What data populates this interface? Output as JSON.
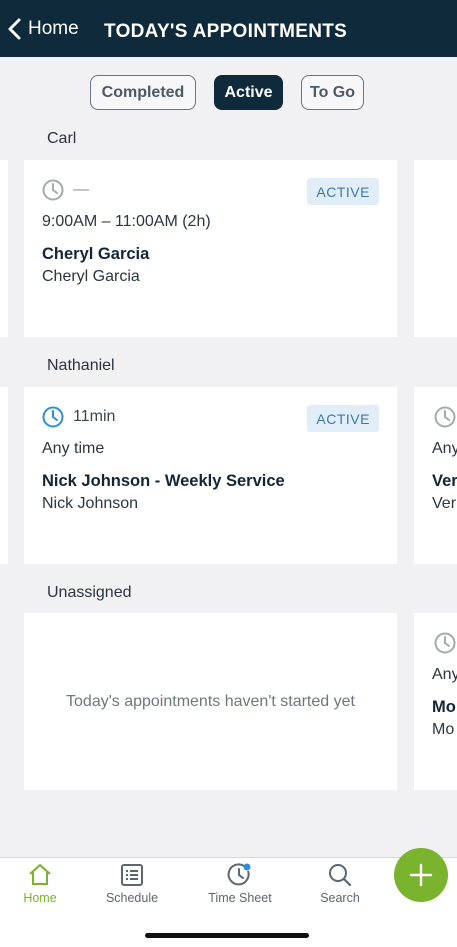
{
  "header": {
    "back_label": "Home",
    "title": "TODAY'S APPOINTMENTS",
    "background_color": "#0f2a3b"
  },
  "filters": [
    {
      "label": "Completed",
      "selected": false
    },
    {
      "label": "Active",
      "selected": true
    },
    {
      "label": "To Go",
      "selected": false
    }
  ],
  "groups": [
    {
      "name": "Carl",
      "card": {
        "duration": "—",
        "status": "ACTIVE",
        "time": "9:00AM – 11:00AM (2h)",
        "title": "Cheryl Garcia",
        "customer": "Cheryl Garcia",
        "clock_color": "#9aa2a9"
      }
    },
    {
      "name": "Nathaniel",
      "card": {
        "duration": "11min",
        "status": "ACTIVE",
        "time": "Any time",
        "title": "Nick Johnson - Weekly Service",
        "customer": "Nick Johnson",
        "clock_color": "#2f8fd6"
      },
      "next_card_peek": {
        "time": "Any",
        "title": "Ver",
        "customer": "Ver"
      }
    },
    {
      "name": "Unassigned",
      "empty_message": "Today's appointments haven't started yet",
      "next_card_peek": {
        "time": "Any",
        "title": "Mo",
        "customer": "Mo"
      }
    }
  ],
  "tabbar": {
    "items": [
      {
        "label": "Home",
        "icon": "home-icon",
        "active": true
      },
      {
        "label": "Schedule",
        "icon": "schedule-list-icon",
        "active": false
      },
      {
        "label": "Time Sheet",
        "icon": "time-sheet-clock-icon",
        "active": false
      },
      {
        "label": "Search",
        "icon": "search-icon",
        "active": false
      }
    ],
    "accent_color": "#79b22c",
    "fab_icon": "plus-icon"
  }
}
